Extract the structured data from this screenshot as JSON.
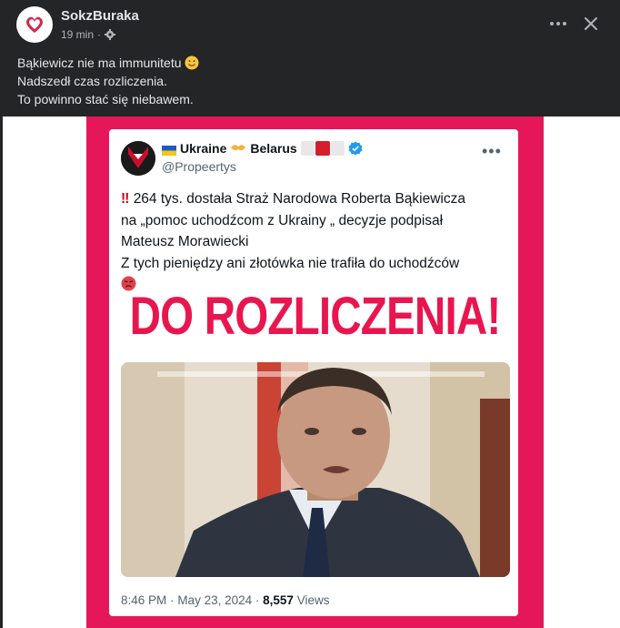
{
  "post": {
    "author": "SokzBuraka",
    "time": "19 min",
    "separator": "·",
    "caption": [
      "Bąkiewicz nie ma immunitetu",
      "Nadszedł czas rozliczenia.",
      "To powinno stać się niebawem."
    ]
  },
  "tweet": {
    "name_part1": "Ukraine",
    "name_part2": "Belarus",
    "handle": "@Propeertys",
    "bangs": "‼",
    "body": [
      "264 tys. dostała Straż Narodowa Roberta Bąkiewicza",
      "na „pomoc uchodźcom z Ukrainy „ decyzje podpisał",
      "Mateusz Morawiecki",
      "Z tych pieniędzy ani złotówka nie trafiła do uchodźców"
    ],
    "time": "8:46 PM",
    "dot": "·",
    "date": "May 23, 2024",
    "views_count": "8,557",
    "views_label": "Views"
  },
  "overlay": {
    "headline": "DO ROZLICZENIA!"
  },
  "icons": {
    "avatar": "heart-icon",
    "audience": "gear-icon",
    "more": "more-horizontal-icon",
    "close": "close-icon",
    "emoji": "smile-emoji-icon",
    "verified": "verified-badge-icon"
  },
  "colors": {
    "background": "#242526",
    "poster_frame": "#e5175a",
    "headline": "#e8164f",
    "verified": "#1d9bf0"
  }
}
